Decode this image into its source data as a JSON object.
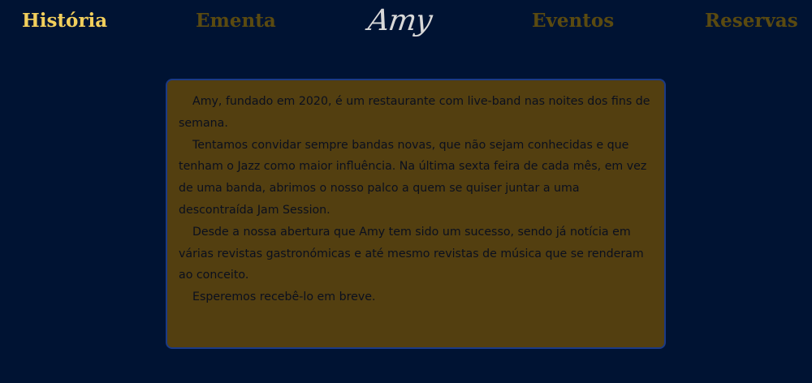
{
  "nav": {
    "items": [
      {
        "label": "História",
        "active": true
      },
      {
        "label": "Ementa",
        "active": false
      },
      {
        "label": "Eventos",
        "active": false
      },
      {
        "label": "Reservas",
        "active": false
      }
    ],
    "logo": "Amy"
  },
  "content": {
    "paragraphs": [
      "Amy, fundado em 2020, é um restaurante com live-band nas noites dos fins de semana.",
      "Tentamos convidar sempre bandas novas, que não sejam conhecidas e que tenham o Jazz como maior influência. Na última sexta feira de cada mês, em vez de uma banda, abrimos o nosso palco a quem se quiser juntar a uma descontraída Jam Session.",
      "Desde a nossa abertura que Amy tem sido um sucesso, sendo já notícia em várias revistas gastronómicas e até mesmo revistas de música que se renderam ao conceito.",
      "Esperemos recebê-lo em breve."
    ]
  },
  "colors": {
    "background": "#001333",
    "active_nav": "#f2cf5c",
    "inactive_nav": "#5a4a10",
    "card_background": "#533f10",
    "card_border": "#1b3a86",
    "logo": "#d9d9d9"
  }
}
